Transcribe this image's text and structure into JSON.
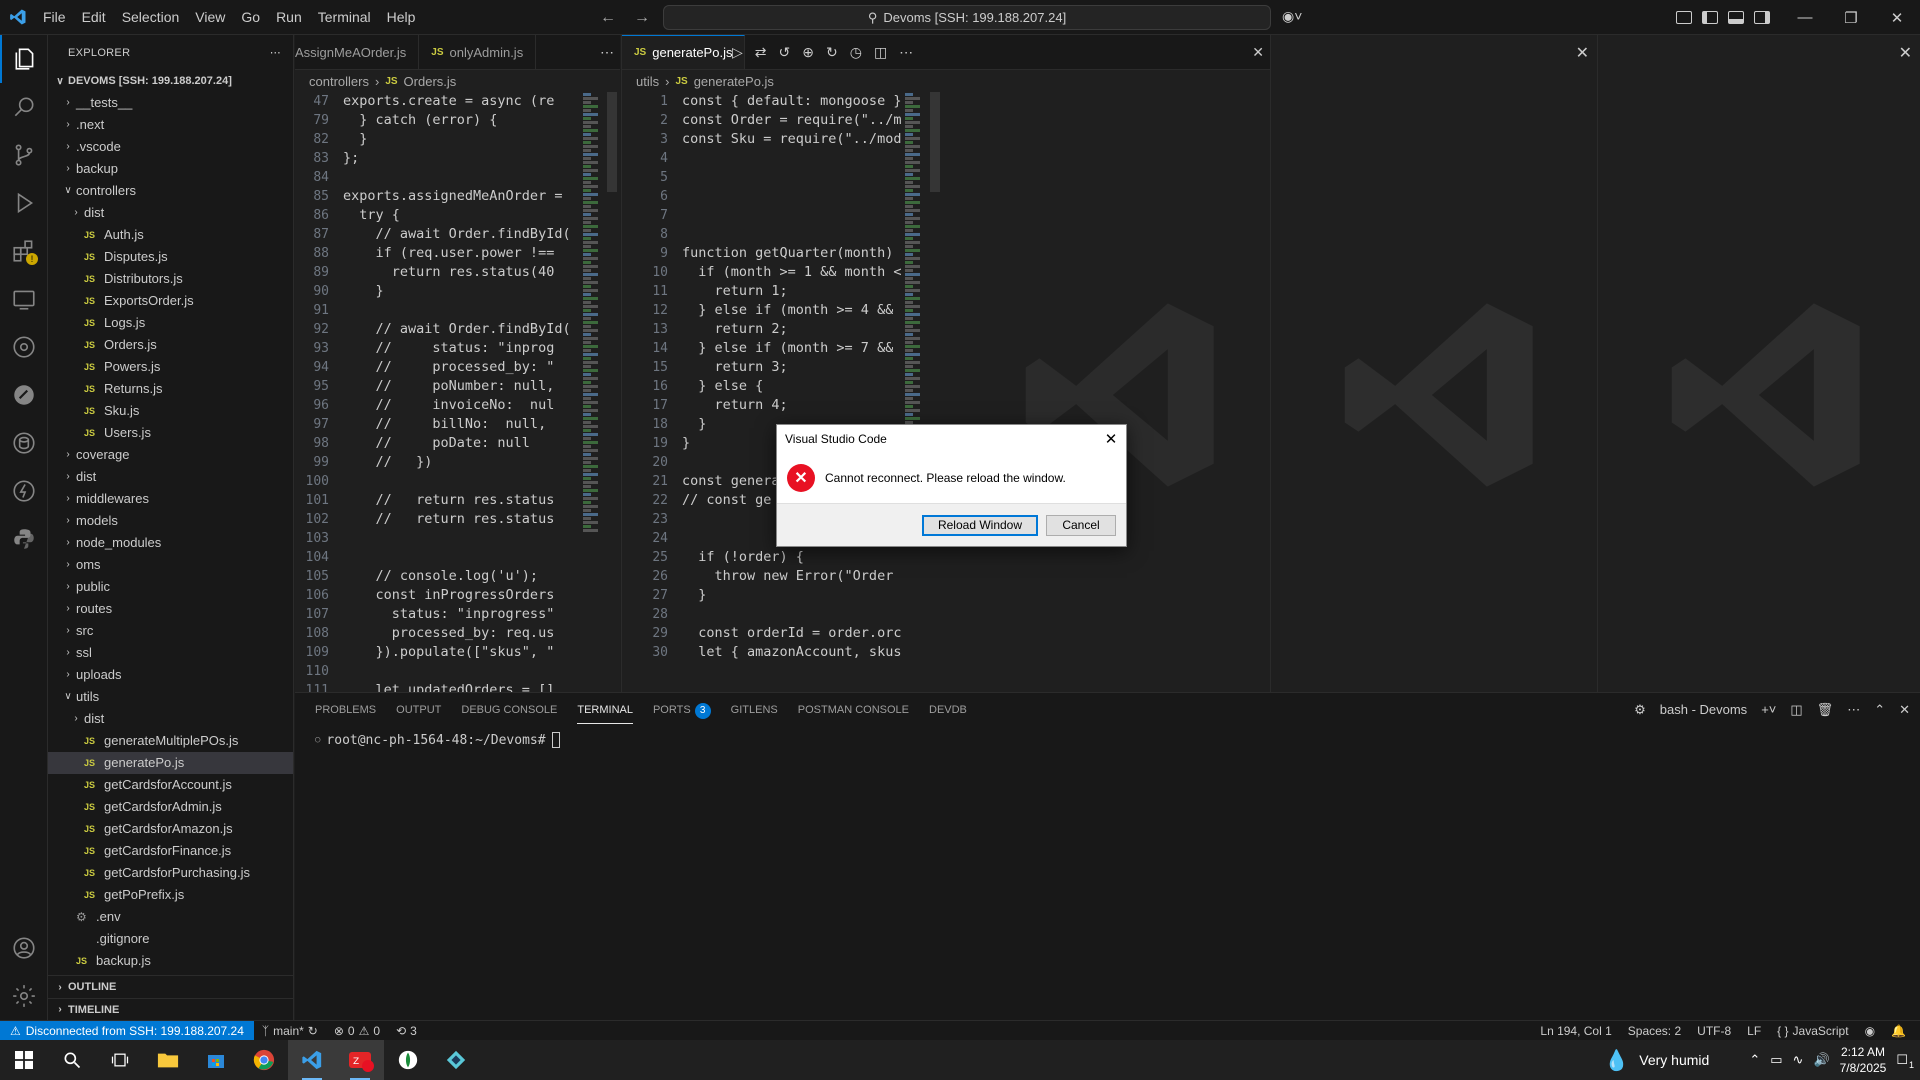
{
  "menu": [
    "File",
    "Edit",
    "Selection",
    "View",
    "Go",
    "Run",
    "Terminal",
    "Help"
  ],
  "command_center": "Devoms [SSH: 199.188.207.24]",
  "explorer": {
    "header": "EXPLORER",
    "root": "DEVOMS [SSH: 199.188.207.24]",
    "items": [
      {
        "label": "__tests__",
        "type": "folder",
        "depth": 1,
        "open": false
      },
      {
        "label": ".next",
        "type": "folder",
        "depth": 1,
        "open": false
      },
      {
        "label": ".vscode",
        "type": "folder",
        "depth": 1,
        "open": false
      },
      {
        "label": "backup",
        "type": "folder",
        "depth": 1,
        "open": false
      },
      {
        "label": "controllers",
        "type": "folder",
        "depth": 1,
        "open": true
      },
      {
        "label": "dist",
        "type": "folder",
        "depth": 2,
        "open": false
      },
      {
        "label": "Auth.js",
        "type": "js",
        "depth": 2
      },
      {
        "label": "Disputes.js",
        "type": "js",
        "depth": 2
      },
      {
        "label": "Distributors.js",
        "type": "js",
        "depth": 2
      },
      {
        "label": "ExportsOrder.js",
        "type": "js",
        "depth": 2
      },
      {
        "label": "Logs.js",
        "type": "js",
        "depth": 2
      },
      {
        "label": "Orders.js",
        "type": "js",
        "depth": 2
      },
      {
        "label": "Powers.js",
        "type": "js",
        "depth": 2
      },
      {
        "label": "Returns.js",
        "type": "js",
        "depth": 2
      },
      {
        "label": "Sku.js",
        "type": "js",
        "depth": 2
      },
      {
        "label": "Users.js",
        "type": "js",
        "depth": 2
      },
      {
        "label": "coverage",
        "type": "folder",
        "depth": 1,
        "open": false
      },
      {
        "label": "dist",
        "type": "folder",
        "depth": 1,
        "open": false
      },
      {
        "label": "middlewares",
        "type": "folder",
        "depth": 1,
        "open": false
      },
      {
        "label": "models",
        "type": "folder",
        "depth": 1,
        "open": false
      },
      {
        "label": "node_modules",
        "type": "folder",
        "depth": 1,
        "open": false
      },
      {
        "label": "oms",
        "type": "folder",
        "depth": 1,
        "open": false
      },
      {
        "label": "public",
        "type": "folder",
        "depth": 1,
        "open": false
      },
      {
        "label": "routes",
        "type": "folder",
        "depth": 1,
        "open": false
      },
      {
        "label": "src",
        "type": "folder",
        "depth": 1,
        "open": false
      },
      {
        "label": "ssl",
        "type": "folder",
        "depth": 1,
        "open": false
      },
      {
        "label": "uploads",
        "type": "folder",
        "depth": 1,
        "open": false
      },
      {
        "label": "utils",
        "type": "folder",
        "depth": 1,
        "open": true
      },
      {
        "label": "dist",
        "type": "folder",
        "depth": 2,
        "open": false
      },
      {
        "label": "generateMultiplePOs.js",
        "type": "js",
        "depth": 2
      },
      {
        "label": "generatePo.js",
        "type": "js",
        "depth": 2,
        "selected": true
      },
      {
        "label": "getCardsforAccount.js",
        "type": "js",
        "depth": 2
      },
      {
        "label": "getCardsforAdmin.js",
        "type": "js",
        "depth": 2
      },
      {
        "label": "getCardsforAmazon.js",
        "type": "js",
        "depth": 2
      },
      {
        "label": "getCardsforFinance.js",
        "type": "js",
        "depth": 2
      },
      {
        "label": "getCardsforPurchasing.js",
        "type": "js",
        "depth": 2
      },
      {
        "label": "getPoPrefix.js",
        "type": "js",
        "depth": 2
      },
      {
        "label": ".env",
        "type": "gear",
        "depth": 1
      },
      {
        "label": ".gitignore",
        "type": "plain",
        "depth": 1
      },
      {
        "label": "backup.js",
        "type": "js",
        "depth": 1
      }
    ],
    "outline": "OUTLINE",
    "timeline": "TIMELINE"
  },
  "editor_left": {
    "tabs": [
      "AssignMeAOrder.js",
      "onlyAdmin.js"
    ],
    "breadcrumb": [
      "controllers",
      "Orders.js"
    ],
    "lines": [
      {
        "n": "47",
        "t": "exports.create = async (re"
      },
      {
        "n": "79",
        "t": "  } catch (error) {"
      },
      {
        "n": "82",
        "t": "  }"
      },
      {
        "n": "83",
        "t": "};"
      },
      {
        "n": "84",
        "t": ""
      },
      {
        "n": "85",
        "t": "exports.assignedMeAnOrder ="
      },
      {
        "n": "86",
        "t": "  try {"
      },
      {
        "n": "87",
        "t": "    // await Order.findById("
      },
      {
        "n": "88",
        "t": "    if (req.user.power !=="
      },
      {
        "n": "89",
        "t": "      return res.status(40"
      },
      {
        "n": "90",
        "t": "    }"
      },
      {
        "n": "91",
        "t": ""
      },
      {
        "n": "92",
        "t": "    // await Order.findById("
      },
      {
        "n": "93",
        "t": "    //     status: \"inprog"
      },
      {
        "n": "94",
        "t": "    //     processed_by: \""
      },
      {
        "n": "95",
        "t": "    //     poNumber: null,"
      },
      {
        "n": "96",
        "t": "    //     invoiceNo:  nul"
      },
      {
        "n": "97",
        "t": "    //     billNo:  null,"
      },
      {
        "n": "98",
        "t": "    //     poDate: null"
      },
      {
        "n": "99",
        "t": "    //   })"
      },
      {
        "n": "100",
        "t": ""
      },
      {
        "n": "101",
        "t": "    //   return res.status"
      },
      {
        "n": "102",
        "t": "    //   return res.status"
      },
      {
        "n": "103",
        "t": ""
      },
      {
        "n": "104",
        "t": ""
      },
      {
        "n": "105",
        "t": "    // console.log('u');"
      },
      {
        "n": "106",
        "t": "    const inProgressOrders"
      },
      {
        "n": "107",
        "t": "      status: \"inprogress\""
      },
      {
        "n": "108",
        "t": "      processed_by: req.us"
      },
      {
        "n": "109",
        "t": "    }).populate([\"skus\", \""
      },
      {
        "n": "110",
        "t": ""
      },
      {
        "n": "111",
        "t": "    let updatedOrders = []"
      }
    ]
  },
  "editor_right": {
    "tab": "generatePo.js",
    "breadcrumb": [
      "utils",
      "generatePo.js"
    ],
    "lines": [
      {
        "n": "1",
        "t": "const { default: mongoose }"
      },
      {
        "n": "2",
        "t": "const Order = require(\"../m"
      },
      {
        "n": "3",
        "t": "const Sku = require(\"../mod"
      },
      {
        "n": "4",
        "t": ""
      },
      {
        "n": "5",
        "t": ""
      },
      {
        "n": "6",
        "t": ""
      },
      {
        "n": "7",
        "t": ""
      },
      {
        "n": "8",
        "t": ""
      },
      {
        "n": "9",
        "t": "function getQuarter(month)"
      },
      {
        "n": "10",
        "t": "  if (month >= 1 && month <"
      },
      {
        "n": "11",
        "t": "    return 1;"
      },
      {
        "n": "12",
        "t": "  } else if (month >= 4 &&"
      },
      {
        "n": "13",
        "t": "    return 2;"
      },
      {
        "n": "14",
        "t": "  } else if (month >= 7 &&"
      },
      {
        "n": "15",
        "t": "    return 3;"
      },
      {
        "n": "16",
        "t": "  } else {"
      },
      {
        "n": "17",
        "t": "    return 4;"
      },
      {
        "n": "18",
        "t": "  }"
      },
      {
        "n": "19",
        "t": "}"
      },
      {
        "n": "20",
        "t": ""
      },
      {
        "n": "21",
        "t": "const genera"
      },
      {
        "n": "22",
        "t": "// const ge"
      },
      {
        "n": "23",
        "t": ""
      },
      {
        "n": "24",
        "t": ""
      },
      {
        "n": "25",
        "t": "  if (!order) {"
      },
      {
        "n": "26",
        "t": "    throw new Error(\"Order"
      },
      {
        "n": "27",
        "t": "  }"
      },
      {
        "n": "28",
        "t": ""
      },
      {
        "n": "29",
        "t": "  const orderId = order.orc"
      },
      {
        "n": "30",
        "t": "  let { amazonAccount, skus"
      }
    ]
  },
  "panel": {
    "tabs": [
      "PROBLEMS",
      "OUTPUT",
      "DEBUG CONSOLE",
      "TERMINAL",
      "PORTS",
      "GITLENS",
      "POSTMAN CONSOLE",
      "DEVDB"
    ],
    "active_tab": "TERMINAL",
    "ports_count": "3",
    "terminal_name": "bash - Devoms",
    "prompt": "root@nc-ph-1564-48:~/Devoms#"
  },
  "statusbar": {
    "remote": "Disconnected from SSH: 199.188.207.24",
    "branch": "main*",
    "errors": "0",
    "warnings": "0",
    "ports": "3",
    "position": "Ln 194, Col 1",
    "spaces": "Spaces: 2",
    "encoding": "UTF-8",
    "eol": "LF",
    "language": "JavaScript"
  },
  "dialog": {
    "title": "Visual Studio Code",
    "message": "Cannot reconnect. Please reload the window.",
    "primary": "Reload Window",
    "secondary": "Cancel"
  },
  "taskbar": {
    "weather": "Very humid",
    "time": "2:12 AM",
    "date": "7/8/2025",
    "notifications": "1",
    "zoom_badge": "3"
  },
  "colors": {
    "accent": "#0078d4",
    "error": "#e81123",
    "js_icon": "#cbcb41"
  }
}
